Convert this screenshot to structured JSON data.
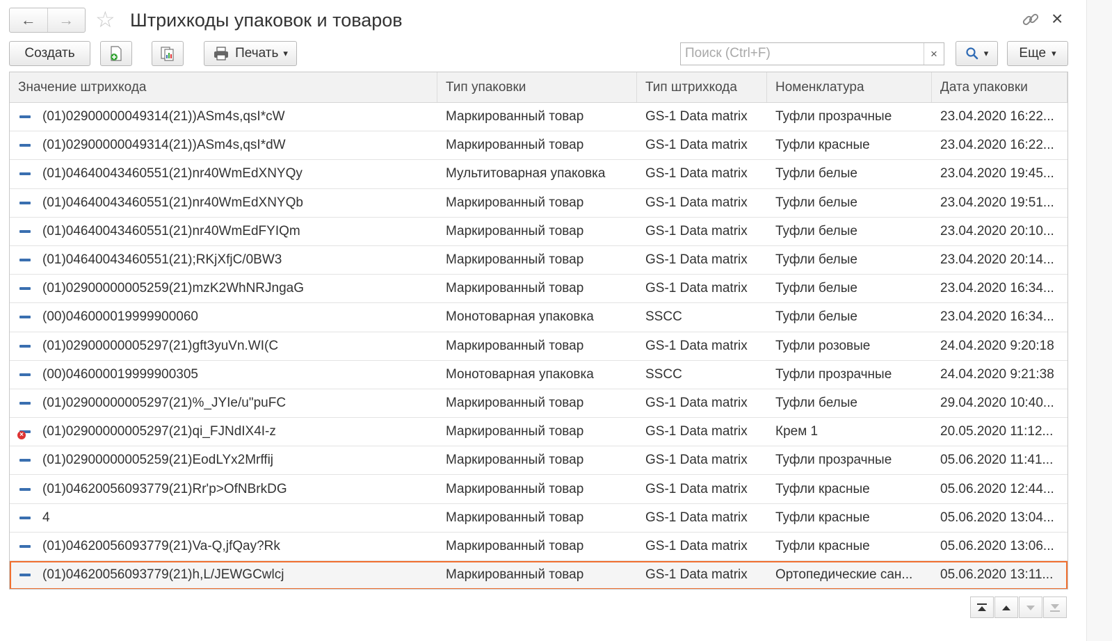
{
  "window": {
    "title": "Штрихкоды упаковок и товаров",
    "back_icon": "←",
    "forward_icon": "→",
    "favorite_icon": "☆",
    "close_icon": "×"
  },
  "toolbar": {
    "create_label": "Создать",
    "print_label": "Печать",
    "more_label": "Еще",
    "search_placeholder": "Поиск (Ctrl+F)",
    "search_clear": "×",
    "dropdown_arrow": "▾"
  },
  "grid": {
    "columns": [
      "Значение штрихкода",
      "Тип упаковки",
      "Тип штрихкода",
      "Номенклатура",
      "Дата упаковки"
    ],
    "rows": [
      {
        "barcode": "(01)02900000049314(21))ASm4s,qsI*cW",
        "package_type": "Маркированный товар",
        "barcode_type": "GS-1 Data matrix",
        "nomenclature": "Туфли прозрачные",
        "date": "23.04.2020 16:22...",
        "deleted": false
      },
      {
        "barcode": "(01)02900000049314(21))ASm4s,qsI*dW",
        "package_type": "Маркированный товар",
        "barcode_type": "GS-1 Data matrix",
        "nomenclature": "Туфли красные",
        "date": "23.04.2020 16:22...",
        "deleted": false
      },
      {
        "barcode": "(01)04640043460551(21)nr40WmEdXNYQy",
        "package_type": "Мультитоварная упаковка",
        "barcode_type": "GS-1 Data matrix",
        "nomenclature": "Туфли белые",
        "date": "23.04.2020 19:45...",
        "deleted": false
      },
      {
        "barcode": "(01)04640043460551(21)nr40WmEdXNYQb",
        "package_type": "Маркированный товар",
        "barcode_type": "GS-1 Data matrix",
        "nomenclature": "Туфли белые",
        "date": "23.04.2020 19:51...",
        "deleted": false
      },
      {
        "barcode": "(01)04640043460551(21)nr40WmEdFYIQm",
        "package_type": "Маркированный товар",
        "barcode_type": "GS-1 Data matrix",
        "nomenclature": "Туфли белые",
        "date": "23.04.2020 20:10...",
        "deleted": false
      },
      {
        "barcode": "(01)04640043460551(21);RKjXfjC/0BW3",
        "package_type": "Маркированный товар",
        "barcode_type": "GS-1 Data matrix",
        "nomenclature": "Туфли белые",
        "date": "23.04.2020 20:14...",
        "deleted": false
      },
      {
        "barcode": "(01)02900000005259(21)mzK2WhNRJngaG",
        "package_type": "Маркированный товар",
        "barcode_type": "GS-1 Data matrix",
        "nomenclature": "Туфли белые",
        "date": "23.04.2020 16:34...",
        "deleted": false
      },
      {
        "barcode": "(00)046000019999900060",
        "package_type": "Монотоварная упаковка",
        "barcode_type": "SSCC",
        "nomenclature": "Туфли белые",
        "date": "23.04.2020 16:34...",
        "deleted": false
      },
      {
        "barcode": "(01)02900000005297(21)gft3yuVn.WI(C",
        "package_type": "Маркированный товар",
        "barcode_type": "GS-1 Data matrix",
        "nomenclature": "Туфли розовые",
        "date": "24.04.2020 9:20:18",
        "deleted": false
      },
      {
        "barcode": "(00)046000019999900305",
        "package_type": "Монотоварная упаковка",
        "barcode_type": "SSCC",
        "nomenclature": "Туфли прозрачные",
        "date": "24.04.2020 9:21:38",
        "deleted": false
      },
      {
        "barcode": "(01)02900000005297(21)%_JYIe/u\"puFC",
        "package_type": "Маркированный товар",
        "barcode_type": "GS-1 Data matrix",
        "nomenclature": "Туфли белые",
        "date": "29.04.2020 10:40...",
        "deleted": false
      },
      {
        "barcode": "(01)02900000005297(21)qi_FJNdIX4I-z",
        "package_type": "Маркированный товар",
        "barcode_type": "GS-1 Data matrix",
        "nomenclature": "Крем 1",
        "date": "20.05.2020 11:12...",
        "deleted": true
      },
      {
        "barcode": "(01)02900000005259(21)EodLYx2Mrffij",
        "package_type": "Маркированный товар",
        "barcode_type": "GS-1 Data matrix",
        "nomenclature": "Туфли прозрачные",
        "date": "05.06.2020 11:41...",
        "deleted": false
      },
      {
        "barcode": "(01)04620056093779(21)Rr'p>OfNBrkDG",
        "package_type": "Маркированный товар",
        "barcode_type": "GS-1 Data matrix",
        "nomenclature": "Туфли красные",
        "date": "05.06.2020 12:44...",
        "deleted": false
      },
      {
        "barcode": "4",
        "package_type": "Маркированный товар",
        "barcode_type": "GS-1 Data matrix",
        "nomenclature": "Туфли красные",
        "date": "05.06.2020 13:04...",
        "deleted": false
      },
      {
        "barcode": "(01)04620056093779(21)Va-Q,jfQay?Rk",
        "package_type": "Маркированный товар",
        "barcode_type": "GS-1 Data matrix",
        "nomenclature": "Туфли красные",
        "date": "05.06.2020 13:06...",
        "deleted": false
      },
      {
        "barcode": "(01)04620056093779(21)h,L/JEWGCwlcj",
        "package_type": "Маркированный товар",
        "barcode_type": "GS-1 Data matrix",
        "nomenclature": "Ортопедические сан...",
        "date": "05.06.2020 13:11...",
        "deleted": false,
        "selected": true
      }
    ]
  },
  "colors": {
    "selection_border": "#f07030",
    "row_icon": "#3a6fb0",
    "deleted_mark": "#d33333"
  },
  "icons": {
    "row_icon": "barcode-record-icon",
    "deleted_icon": "deleted-mark-icon",
    "scroll_first": "⏶",
    "scroll_up": "▲",
    "scroll_down": "▼",
    "scroll_last": "⏷"
  }
}
